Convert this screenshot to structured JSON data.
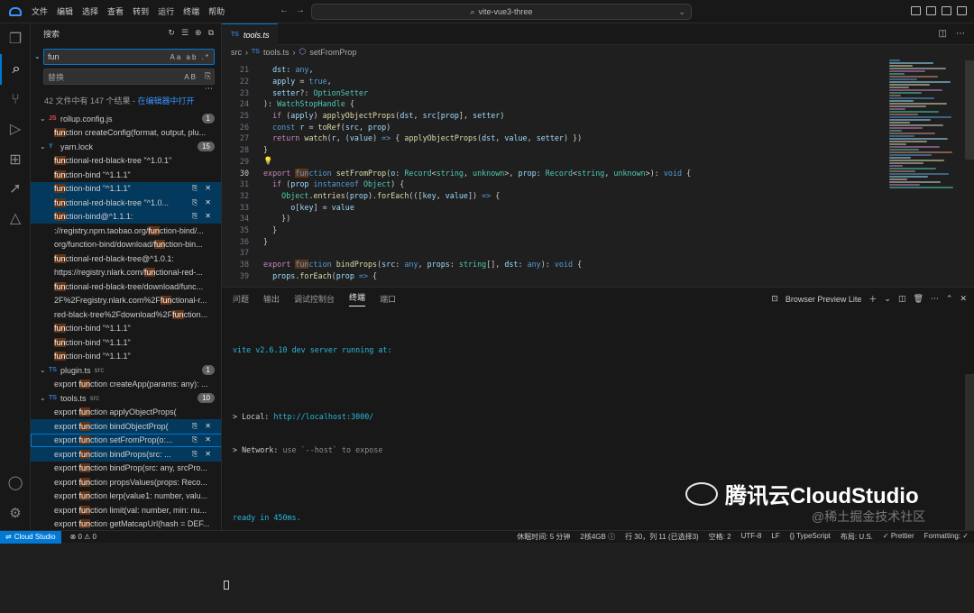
{
  "titlebar": {
    "menu": [
      "文件",
      "编辑",
      "选择",
      "查看",
      "转到",
      "运行",
      "终端",
      "帮助"
    ],
    "command_center": "vite-vue3-three"
  },
  "activity_bar": [
    "explorer-icon",
    "search-icon",
    "source-control-icon",
    "run-debug-icon",
    "extensions-icon",
    "deploy-icon",
    "preview-icon",
    "account-icon",
    "manage-icon"
  ],
  "sidebar": {
    "title": "搜索",
    "find_value": "fun",
    "find_options": "Aa ab .*",
    "replace_placeholder": "替换",
    "replace_option": "AB",
    "summary": "42 文件中有 147 个结果 - ",
    "open_in_editor": "在编辑器中打开",
    "results": [
      {
        "type": "file",
        "name": "rollup.config.js",
        "dir": "",
        "count": "1",
        "icon": "JS",
        "icon_color": "#e34c4c"
      },
      {
        "type": "match",
        "pre": "",
        "hit": "fun",
        "post": "ction createConfig(format, output, plu..."
      },
      {
        "type": "file",
        "name": "yarn.lock",
        "dir": "",
        "count": "15",
        "icon": "Y",
        "icon_color": "#2c8ebb"
      },
      {
        "type": "match",
        "pre": "",
        "hit": "fun",
        "post": "ctional-red-black-tree \"^1.0.1\""
      },
      {
        "type": "match",
        "pre": "",
        "hit": "fun",
        "post": "ction-bind \"^1.1.1\""
      },
      {
        "type": "match",
        "pre": "",
        "hit": "fun",
        "post": "ction-bind \"^1.1.1\"",
        "state": "sel"
      },
      {
        "type": "match",
        "pre": "",
        "hit": "fun",
        "post": "ctional-red-black-tree \"^1.0...",
        "state": "sel"
      },
      {
        "type": "match",
        "pre": "",
        "hit": "fun",
        "post": "ction-bind@^1.1.1:",
        "state": "sel"
      },
      {
        "type": "match",
        "pre": "://registry.npm.taobao.org/",
        "hit": "fun",
        "post": "ction-bind/..."
      },
      {
        "type": "match",
        "pre": "org/function-bind/download/",
        "hit": "fun",
        "post": "ction-bin..."
      },
      {
        "type": "match",
        "pre": "",
        "hit": "fun",
        "post": "ctional-red-black-tree@^1.0.1:"
      },
      {
        "type": "match",
        "pre": "https://registry.nlark.com/",
        "hit": "fun",
        "post": "ctional-red-..."
      },
      {
        "type": "match",
        "pre": "",
        "hit": "fun",
        "post": "ctional-red-black-tree/download/func..."
      },
      {
        "type": "match",
        "pre": "2F%2Fregistry.nlark.com%2F",
        "hit": "fun",
        "post": "ctional-r..."
      },
      {
        "type": "match",
        "pre": "red-black-tree%2Fdownload%2F",
        "hit": "fun",
        "post": "ction..."
      },
      {
        "type": "match",
        "pre": "",
        "hit": "fun",
        "post": "ction-bind \"^1.1.1\""
      },
      {
        "type": "match",
        "pre": "",
        "hit": "fun",
        "post": "ction-bind \"^1.1.1\""
      },
      {
        "type": "match",
        "pre": "",
        "hit": "fun",
        "post": "ction-bind \"^1.1.1\""
      },
      {
        "type": "file",
        "name": "plugin.ts",
        "dir": "src",
        "count": "1",
        "icon": "TS",
        "icon_color": "#3178c6"
      },
      {
        "type": "match",
        "pre": "export ",
        "hit": "fun",
        "post": "ction createApp(params: any): ..."
      },
      {
        "type": "file",
        "name": "tools.ts",
        "dir": "src",
        "count": "10",
        "icon": "TS",
        "icon_color": "#3178c6"
      },
      {
        "type": "match",
        "pre": "export ",
        "hit": "fun",
        "post": "ction applyObjectProps("
      },
      {
        "type": "match",
        "pre": "export ",
        "hit": "fun",
        "post": "ction bindObjectProp(",
        "state": "sel"
      },
      {
        "type": "match",
        "pre": "export ",
        "hit": "fun",
        "post": "ction setFromProp(o:...",
        "state": "focus"
      },
      {
        "type": "match",
        "pre": "export ",
        "hit": "fun",
        "post": "ction bindProps(src: ...",
        "state": "sel"
      },
      {
        "type": "match",
        "pre": "export ",
        "hit": "fun",
        "post": "ction bindProp(src: any, srcPro..."
      },
      {
        "type": "match",
        "pre": "export ",
        "hit": "fun",
        "post": "ction propsValues(props: Reco..."
      },
      {
        "type": "match",
        "pre": "export ",
        "hit": "fun",
        "post": "ction lerp(value1: number, valu..."
      },
      {
        "type": "match",
        "pre": "export ",
        "hit": "fun",
        "post": "ction limit(val: number, min: nu..."
      },
      {
        "type": "match",
        "pre": "export ",
        "hit": "fun",
        "post": "ction getMatcapUrl(hash = DEF..."
      }
    ]
  },
  "editor": {
    "tab": "tools.ts",
    "tab_icon": "TS",
    "breadcrumb": [
      "src",
      "tools.ts",
      "setFromProp"
    ],
    "current_line": "30",
    "lines": [
      {
        "n": "21",
        "html": "  <span class='v'>dst</span><span class='p'>: </span><span class='k'>any</span><span class='p'>,</span>"
      },
      {
        "n": "22",
        "html": "  <span class='v'>apply</span><span class='p'> = </span><span class='k'>true</span><span class='p'>,</span>"
      },
      {
        "n": "23",
        "html": "  <span class='v'>setter</span><span class='p'>?: </span><span class='t'>OptionSetter</span>"
      },
      {
        "n": "24",
        "html": "<span class='p'>): </span><span class='t'>WatchStopHandle</span><span class='p'> {</span>"
      },
      {
        "n": "25",
        "html": "  <span class='kc'>if</span><span class='p'> (</span><span class='v'>apply</span><span class='p'>) </span><span class='f'>applyObjectProps</span><span class='p'>(</span><span class='v'>dst</span><span class='p'>, </span><span class='v'>src</span><span class='p'>[</span><span class='v'>prop</span><span class='p'>], </span><span class='v'>setter</span><span class='p'>)</span>"
      },
      {
        "n": "26",
        "html": "  <span class='k'>const</span><span class='v'> r</span><span class='p'> = </span><span class='f'>toRef</span><span class='p'>(</span><span class='v'>src</span><span class='p'>, </span><span class='v'>prop</span><span class='p'>)</span>"
      },
      {
        "n": "27",
        "html": "  <span class='kc'>return</span><span class='f'> watch</span><span class='p'>(</span><span class='v'>r</span><span class='p'>, (</span><span class='v'>value</span><span class='p'>) </span><span class='k'>=&gt;</span><span class='p'> { </span><span class='f'>applyObjectProps</span><span class='p'>(</span><span class='v'>dst</span><span class='p'>, </span><span class='v'>value</span><span class='p'>, </span><span class='v'>setter</span><span class='p'>) })</span>"
      },
      {
        "n": "28",
        "html": "<span class='p'>}</span>"
      },
      {
        "n": "29",
        "html": "<span class='y'>💡</span>"
      },
      {
        "n": "30",
        "html": "<span class='kc'>export</span><span class='k'> </span><span class='k hlw'>fun</span><span class='k'>ction</span><span class='f'> setFromProp</span><span class='p'>(</span><span class='v'>o</span><span class='p'>: </span><span class='t'>Record</span><span class='p'>&lt;</span><span class='t'>string</span><span class='p'>, </span><span class='t'>unknown</span><span class='p'>&gt;, </span><span class='v'>prop</span><span class='p'>: </span><span class='t'>Record</span><span class='p'>&lt;</span><span class='t'>string</span><span class='p'>, </span><span class='t'>unknown</span><span class='p'>&gt;): </span><span class='k'>void</span><span class='p'> {</span>"
      },
      {
        "n": "31",
        "html": "  <span class='kc'>if</span><span class='p'> (</span><span class='v'>prop</span><span class='k'> instanceof</span><span class='t'> Object</span><span class='p'>) {</span>"
      },
      {
        "n": "32",
        "html": "    <span class='t'>Object</span><span class='p'>.</span><span class='f'>entries</span><span class='p'>(</span><span class='v'>prop</span><span class='p'>).</span><span class='f'>forEach</span><span class='p'>(([</span><span class='v'>key</span><span class='p'>, </span><span class='v'>value</span><span class='p'>]) </span><span class='k'>=&gt;</span><span class='p'> {</span>"
      },
      {
        "n": "33",
        "html": "      <span class='v'>o</span><span class='p'>[</span><span class='v'>key</span><span class='p'>] = </span><span class='v'>value</span>"
      },
      {
        "n": "34",
        "html": "    <span class='p'>})</span>"
      },
      {
        "n": "35",
        "html": "  <span class='p'>}</span>"
      },
      {
        "n": "36",
        "html": "<span class='p'>}</span>"
      },
      {
        "n": "37",
        "html": ""
      },
      {
        "n": "38",
        "html": "<span class='kc'>export</span><span class='k'> </span><span class='k hlw'>fun</span><span class='k'>ction</span><span class='f'> bindProps</span><span class='p'>(</span><span class='v'>src</span><span class='p'>: </span><span class='k'>any</span><span class='p'>, </span><span class='v'>props</span><span class='p'>: </span><span class='t'>string</span><span class='p'>[], </span><span class='v'>dst</span><span class='p'>: </span><span class='k'>any</span><span class='p'>): </span><span class='k'>void</span><span class='p'> {</span>"
      },
      {
        "n": "39",
        "html": "  <span class='v'>props</span><span class='p'>.</span><span class='f'>forEach</span><span class='p'>(</span><span class='v'>prop</span><span class='k'> =&gt;</span><span class='p'> {</span>"
      }
    ]
  },
  "panel": {
    "tabs": [
      "问题",
      "输出",
      "调试控制台",
      "终端",
      "端口"
    ],
    "active_tab": "终端",
    "terminal_name": "Browser Preview Lite",
    "terminal": {
      "line1_prefix": "vite v2.6.10 ",
      "line1_suffix": "dev server running at:",
      "local_label": "> Local: ",
      "local_url": "http://localhost:3000/",
      "network_label": "> Network: ",
      "network_text": "use `--host` to expose",
      "ready": "ready in 450ms."
    }
  },
  "statusbar": {
    "remote": "Cloud Studio",
    "problems": "⊗ 0 ⚠ 0",
    "right": [
      "休眠时间: 5 分钟",
      "2核4GB ⓘ",
      "行 30，列 11 (已选择3)",
      "空格: 2",
      "UTF-8",
      "LF",
      "{} TypeScript",
      "布局: U.S.",
      "✓ Prettier",
      "Formatting: ✓"
    ]
  },
  "watermark": {
    "brand": "腾讯云CloudStudio",
    "sub": "@稀土掘金技术社区"
  }
}
